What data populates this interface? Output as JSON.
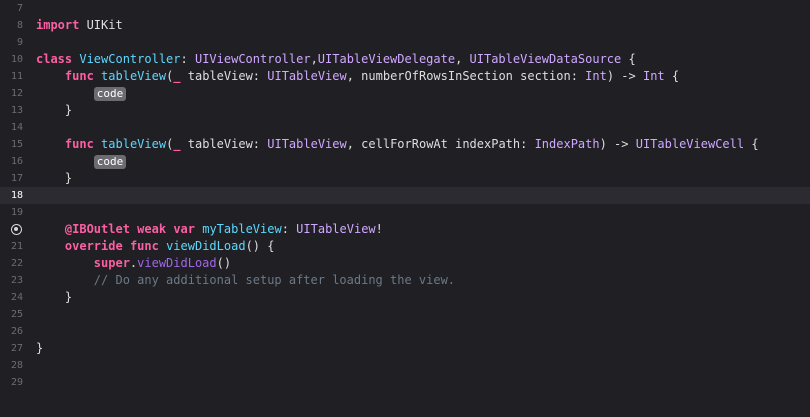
{
  "editor": {
    "line_numbers": [
      "7",
      "8",
      "9",
      "10",
      "11",
      "12",
      "13",
      "14",
      "15",
      "16",
      "17",
      "18",
      "19",
      "",
      "21",
      "22",
      "23",
      "24",
      "25",
      "26",
      "27",
      "28",
      "29"
    ],
    "lines": [
      [],
      [
        {
          "t": "import",
          "c": "kw"
        },
        {
          "t": " UIKit",
          "c": ""
        }
      ],
      [],
      [
        {
          "t": "class",
          "c": "kw"
        },
        {
          "t": " ",
          "c": ""
        },
        {
          "t": "ViewController",
          "c": "decl"
        },
        {
          "t": ": ",
          "c": ""
        },
        {
          "t": "UIViewController",
          "c": "type"
        },
        {
          "t": ",",
          "c": ""
        },
        {
          "t": "UITableViewDelegate",
          "c": "type"
        },
        {
          "t": ", ",
          "c": ""
        },
        {
          "t": "UITableViewDataSource",
          "c": "type"
        },
        {
          "t": " {",
          "c": ""
        }
      ],
      [
        {
          "t": "    ",
          "c": ""
        },
        {
          "t": "func",
          "c": "kw"
        },
        {
          "t": " ",
          "c": ""
        },
        {
          "t": "tableView",
          "c": "decl"
        },
        {
          "t": "(",
          "c": ""
        },
        {
          "t": "_",
          "c": "kw"
        },
        {
          "t": " tableView: ",
          "c": ""
        },
        {
          "t": "UITableView",
          "c": "type"
        },
        {
          "t": ", numberOfRowsInSection section: ",
          "c": ""
        },
        {
          "t": "Int",
          "c": "type"
        },
        {
          "t": ") -> ",
          "c": ""
        },
        {
          "t": "Int",
          "c": "type"
        },
        {
          "t": " {",
          "c": ""
        }
      ],
      [
        {
          "t": "        ",
          "c": ""
        },
        {
          "t": "code",
          "c": "ph"
        }
      ],
      [
        {
          "t": "    }",
          "c": ""
        }
      ],
      [],
      [
        {
          "t": "    ",
          "c": ""
        },
        {
          "t": "func",
          "c": "kw"
        },
        {
          "t": " ",
          "c": ""
        },
        {
          "t": "tableView",
          "c": "decl"
        },
        {
          "t": "(",
          "c": ""
        },
        {
          "t": "_",
          "c": "kw"
        },
        {
          "t": " tableView: ",
          "c": ""
        },
        {
          "t": "UITableView",
          "c": "type"
        },
        {
          "t": ", cellForRowAt indexPath: ",
          "c": ""
        },
        {
          "t": "IndexPath",
          "c": "type"
        },
        {
          "t": ") -> ",
          "c": ""
        },
        {
          "t": "UITableViewCell",
          "c": "type"
        },
        {
          "t": " {",
          "c": ""
        }
      ],
      [
        {
          "t": "        ",
          "c": ""
        },
        {
          "t": "code",
          "c": "ph"
        }
      ],
      [
        {
          "t": "    }",
          "c": ""
        }
      ],
      [],
      [],
      [
        {
          "t": "    ",
          "c": ""
        },
        {
          "t": "@IBOutlet",
          "c": "kw"
        },
        {
          "t": " ",
          "c": ""
        },
        {
          "t": "weak",
          "c": "kw"
        },
        {
          "t": " ",
          "c": ""
        },
        {
          "t": "var",
          "c": "kw"
        },
        {
          "t": " ",
          "c": ""
        },
        {
          "t": "myTableView",
          "c": "decl"
        },
        {
          "t": ": ",
          "c": ""
        },
        {
          "t": "UITableView",
          "c": "type"
        },
        {
          "t": "!",
          "c": ""
        }
      ],
      [
        {
          "t": "    ",
          "c": ""
        },
        {
          "t": "override",
          "c": "kw"
        },
        {
          "t": " ",
          "c": ""
        },
        {
          "t": "func",
          "c": "kw"
        },
        {
          "t": " ",
          "c": ""
        },
        {
          "t": "viewDidLoad",
          "c": "decl"
        },
        {
          "t": "() {",
          "c": ""
        }
      ],
      [
        {
          "t": "        ",
          "c": ""
        },
        {
          "t": "super",
          "c": "kw"
        },
        {
          "t": ".",
          "c": ""
        },
        {
          "t": "viewDidLoad",
          "c": "method"
        },
        {
          "t": "()",
          "c": ""
        }
      ],
      [
        {
          "t": "        // Do any additional setup after loading the view.",
          "c": "cmt"
        }
      ],
      [
        {
          "t": "    }",
          "c": ""
        }
      ],
      [],
      [],
      [
        {
          "t": "}",
          "c": ""
        }
      ],
      [],
      []
    ],
    "current_line_index": 11,
    "breakpoint_line_index": 13,
    "breakpoint_icon": "outlet-connection-icon"
  }
}
